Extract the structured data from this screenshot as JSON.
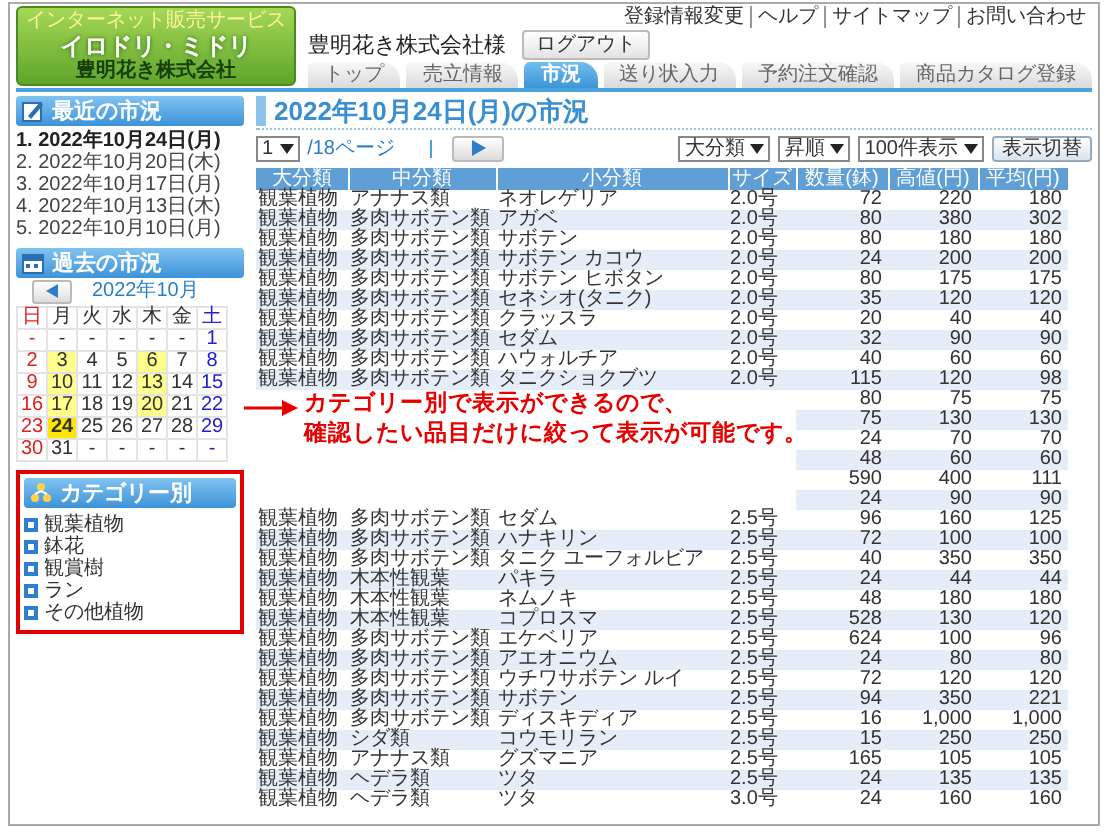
{
  "logo": {
    "tagline": "インターネット販売サービス",
    "name": "イロドリ・ミドリ",
    "company": "豊明花き株式会社"
  },
  "header": {
    "customer": "豊明花き株式会社様",
    "logout": "ログアウト",
    "links": [
      "登録情報変更",
      "ヘルプ",
      "サイトマップ",
      "お問い合わせ"
    ]
  },
  "tabs": [
    {
      "label": "トップ",
      "selected": false
    },
    {
      "label": "売立情報",
      "selected": false
    },
    {
      "label": "市況",
      "selected": true
    },
    {
      "label": "送り状入力",
      "selected": false
    },
    {
      "label": "予約注文確認",
      "selected": false
    },
    {
      "label": "商品カタログ登録",
      "selected": false
    }
  ],
  "sidebar": {
    "recent": {
      "title": "最近の市況",
      "items": [
        {
          "label": "1. 2022年10月24日(月)",
          "selected": true
        },
        {
          "label": "2. 2022年10月20日(木)",
          "selected": false
        },
        {
          "label": "3. 2022年10月17日(月)",
          "selected": false
        },
        {
          "label": "4. 2022年10月13日(木)",
          "selected": false
        },
        {
          "label": "5. 2022年10月10日(月)",
          "selected": false
        }
      ]
    },
    "past": {
      "title": "過去の市況",
      "month": "2022年10月",
      "weekdays": [
        "日",
        "月",
        "火",
        "水",
        "木",
        "金",
        "土"
      ],
      "weeks": [
        [
          {
            "day": "-",
            "marked": false,
            "selected": false
          },
          {
            "day": "-",
            "marked": false,
            "selected": false
          },
          {
            "day": "-",
            "marked": false,
            "selected": false
          },
          {
            "day": "-",
            "marked": false,
            "selected": false
          },
          {
            "day": "-",
            "marked": false,
            "selected": false
          },
          {
            "day": "-",
            "marked": false,
            "selected": false
          },
          {
            "day": "1",
            "marked": false,
            "selected": false
          }
        ],
        [
          {
            "day": "2",
            "marked": false,
            "selected": false
          },
          {
            "day": "3",
            "marked": true,
            "selected": false
          },
          {
            "day": "4",
            "marked": false,
            "selected": false
          },
          {
            "day": "5",
            "marked": false,
            "selected": false
          },
          {
            "day": "6",
            "marked": true,
            "selected": false
          },
          {
            "day": "7",
            "marked": false,
            "selected": false
          },
          {
            "day": "8",
            "marked": false,
            "selected": false
          }
        ],
        [
          {
            "day": "9",
            "marked": false,
            "selected": false
          },
          {
            "day": "10",
            "marked": true,
            "selected": false
          },
          {
            "day": "11",
            "marked": false,
            "selected": false
          },
          {
            "day": "12",
            "marked": false,
            "selected": false
          },
          {
            "day": "13",
            "marked": true,
            "selected": false
          },
          {
            "day": "14",
            "marked": false,
            "selected": false
          },
          {
            "day": "15",
            "marked": false,
            "selected": false
          }
        ],
        [
          {
            "day": "16",
            "marked": false,
            "selected": false
          },
          {
            "day": "17",
            "marked": true,
            "selected": false
          },
          {
            "day": "18",
            "marked": false,
            "selected": false
          },
          {
            "day": "19",
            "marked": false,
            "selected": false
          },
          {
            "day": "20",
            "marked": true,
            "selected": false
          },
          {
            "day": "21",
            "marked": false,
            "selected": false
          },
          {
            "day": "22",
            "marked": false,
            "selected": false
          }
        ],
        [
          {
            "day": "23",
            "marked": false,
            "selected": false
          },
          {
            "day": "24",
            "marked": true,
            "selected": true
          },
          {
            "day": "25",
            "marked": false,
            "selected": false
          },
          {
            "day": "26",
            "marked": false,
            "selected": false
          },
          {
            "day": "27",
            "marked": false,
            "selected": false
          },
          {
            "day": "28",
            "marked": false,
            "selected": false
          },
          {
            "day": "29",
            "marked": false,
            "selected": false
          }
        ],
        [
          {
            "day": "30",
            "marked": false,
            "selected": false
          },
          {
            "day": "31",
            "marked": false,
            "selected": false
          },
          {
            "day": "-",
            "marked": false,
            "selected": false
          },
          {
            "day": "-",
            "marked": false,
            "selected": false
          },
          {
            "day": "-",
            "marked": false,
            "selected": false
          },
          {
            "day": "-",
            "marked": false,
            "selected": false
          },
          {
            "day": "-",
            "marked": false,
            "selected": false
          }
        ]
      ]
    },
    "categories": {
      "title": "カテゴリー別",
      "items": [
        "観葉植物",
        "鉢花",
        "観賞樹",
        "ラン",
        "その他植物"
      ]
    }
  },
  "main": {
    "title": "2022年10月24日(月)の市況",
    "page_select": "1",
    "page_count": "/18ページ",
    "selects": [
      "大分類",
      "昇順",
      "100件表示"
    ],
    "switch_button": "表示切替"
  },
  "table": {
    "columns": [
      "大分類",
      "中分類",
      "小分類",
      "サイズ",
      "数量(鉢)",
      "高値(円)",
      "平均(円)"
    ],
    "rows": [
      {
        "category": "観葉植物",
        "subcategory": "アナナス類",
        "item": "ネオレゲリア",
        "size": "2.0号",
        "quantity": "72",
        "high": "220",
        "average": "180"
      },
      {
        "category": "観葉植物",
        "subcategory": "多肉サボテン類",
        "item": "アガベ",
        "size": "2.0号",
        "quantity": "80",
        "high": "380",
        "average": "302"
      },
      {
        "category": "観葉植物",
        "subcategory": "多肉サボテン類",
        "item": "サボテン",
        "size": "2.0号",
        "quantity": "80",
        "high": "180",
        "average": "180"
      },
      {
        "category": "観葉植物",
        "subcategory": "多肉サボテン類",
        "item": "サボテン カコウ",
        "size": "2.0号",
        "quantity": "24",
        "high": "200",
        "average": "200"
      },
      {
        "category": "観葉植物",
        "subcategory": "多肉サボテン類",
        "item": "サボテン ヒボタン",
        "size": "2.0号",
        "quantity": "80",
        "high": "175",
        "average": "175"
      },
      {
        "category": "観葉植物",
        "subcategory": "多肉サボテン類",
        "item": "セネシオ(タニク)",
        "size": "2.0号",
        "quantity": "35",
        "high": "120",
        "average": "120"
      },
      {
        "category": "観葉植物",
        "subcategory": "多肉サボテン類",
        "item": "クラッスラ",
        "size": "2.0号",
        "quantity": "20",
        "high": "40",
        "average": "40"
      },
      {
        "category": "観葉植物",
        "subcategory": "多肉サボテン類",
        "item": "セダム",
        "size": "2.0号",
        "quantity": "32",
        "high": "90",
        "average": "90"
      },
      {
        "category": "観葉植物",
        "subcategory": "多肉サボテン類",
        "item": "ハウォルチア",
        "size": "2.0号",
        "quantity": "40",
        "high": "60",
        "average": "60"
      },
      {
        "category": "観葉植物",
        "subcategory": "多肉サボテン類",
        "item": "タニクショクブツ",
        "size": "2.0号",
        "quantity": "115",
        "high": "120",
        "average": "98"
      },
      {
        "quantity": "80",
        "high": "75",
        "average": "75"
      },
      {
        "quantity": "75",
        "high": "130",
        "average": "130"
      },
      {
        "quantity": "24",
        "high": "70",
        "average": "70"
      },
      {
        "quantity": "48",
        "high": "60",
        "average": "60"
      },
      {
        "quantity": "590",
        "high": "400",
        "average": "111"
      },
      {
        "quantity": "24",
        "high": "90",
        "average": "90"
      },
      {
        "category": "観葉植物",
        "subcategory": "多肉サボテン類",
        "item": "セダム",
        "size": "2.5号",
        "quantity": "96",
        "high": "160",
        "average": "125"
      },
      {
        "category": "観葉植物",
        "subcategory": "多肉サボテン類",
        "item": "ハナキリン",
        "size": "2.5号",
        "quantity": "72",
        "high": "100",
        "average": "100"
      },
      {
        "category": "観葉植物",
        "subcategory": "多肉サボテン類",
        "item": "タニク ユーフォルビア",
        "size": "2.5号",
        "quantity": "40",
        "high": "350",
        "average": "350"
      },
      {
        "category": "観葉植物",
        "subcategory": "木本性観葉",
        "item": "パキラ",
        "size": "2.5号",
        "quantity": "24",
        "high": "44",
        "average": "44"
      },
      {
        "category": "観葉植物",
        "subcategory": "木本性観葉",
        "item": "ネムノキ",
        "size": "2.5号",
        "quantity": "48",
        "high": "180",
        "average": "180"
      },
      {
        "category": "観葉植物",
        "subcategory": "木本性観葉",
        "item": "コプロスマ",
        "size": "2.5号",
        "quantity": "528",
        "high": "130",
        "average": "120"
      },
      {
        "category": "観葉植物",
        "subcategory": "多肉サボテン類",
        "item": "エケベリア",
        "size": "2.5号",
        "quantity": "624",
        "high": "100",
        "average": "96"
      },
      {
        "category": "観葉植物",
        "subcategory": "多肉サボテン類",
        "item": "アエオニウム",
        "size": "2.5号",
        "quantity": "24",
        "high": "80",
        "average": "80"
      },
      {
        "category": "観葉植物",
        "subcategory": "多肉サボテン類",
        "item": "ウチワサボテン ルイ",
        "size": "2.5号",
        "quantity": "72",
        "high": "120",
        "average": "120"
      },
      {
        "category": "観葉植物",
        "subcategory": "多肉サボテン類",
        "item": "サボテン",
        "size": "2.5号",
        "quantity": "94",
        "high": "350",
        "average": "221"
      },
      {
        "category": "観葉植物",
        "subcategory": "多肉サボテン類",
        "item": "ディスキディア",
        "size": "2.5号",
        "quantity": "16",
        "high": "1,000",
        "average": "1,000"
      },
      {
        "category": "観葉植物",
        "subcategory": "シダ類",
        "item": "コウモリラン",
        "size": "2.5号",
        "quantity": "15",
        "high": "250",
        "average": "250"
      },
      {
        "category": "観葉植物",
        "subcategory": "アナナス類",
        "item": "グズマニア",
        "size": "2.5号",
        "quantity": "165",
        "high": "105",
        "average": "105"
      },
      {
        "category": "観葉植物",
        "subcategory": "ヘデラ類",
        "item": "ツタ",
        "size": "2.5号",
        "quantity": "24",
        "high": "135",
        "average": "135"
      },
      {
        "category": "観葉植物",
        "subcategory": "ヘデラ類",
        "item": "ツタ",
        "size": "3.0号",
        "quantity": "24",
        "high": "160",
        "average": "160"
      }
    ]
  },
  "annotation": {
    "lines": [
      "カテゴリー別で表示ができるので、",
      "確認したい品目だけに絞って表示が可能です。"
    ]
  }
}
